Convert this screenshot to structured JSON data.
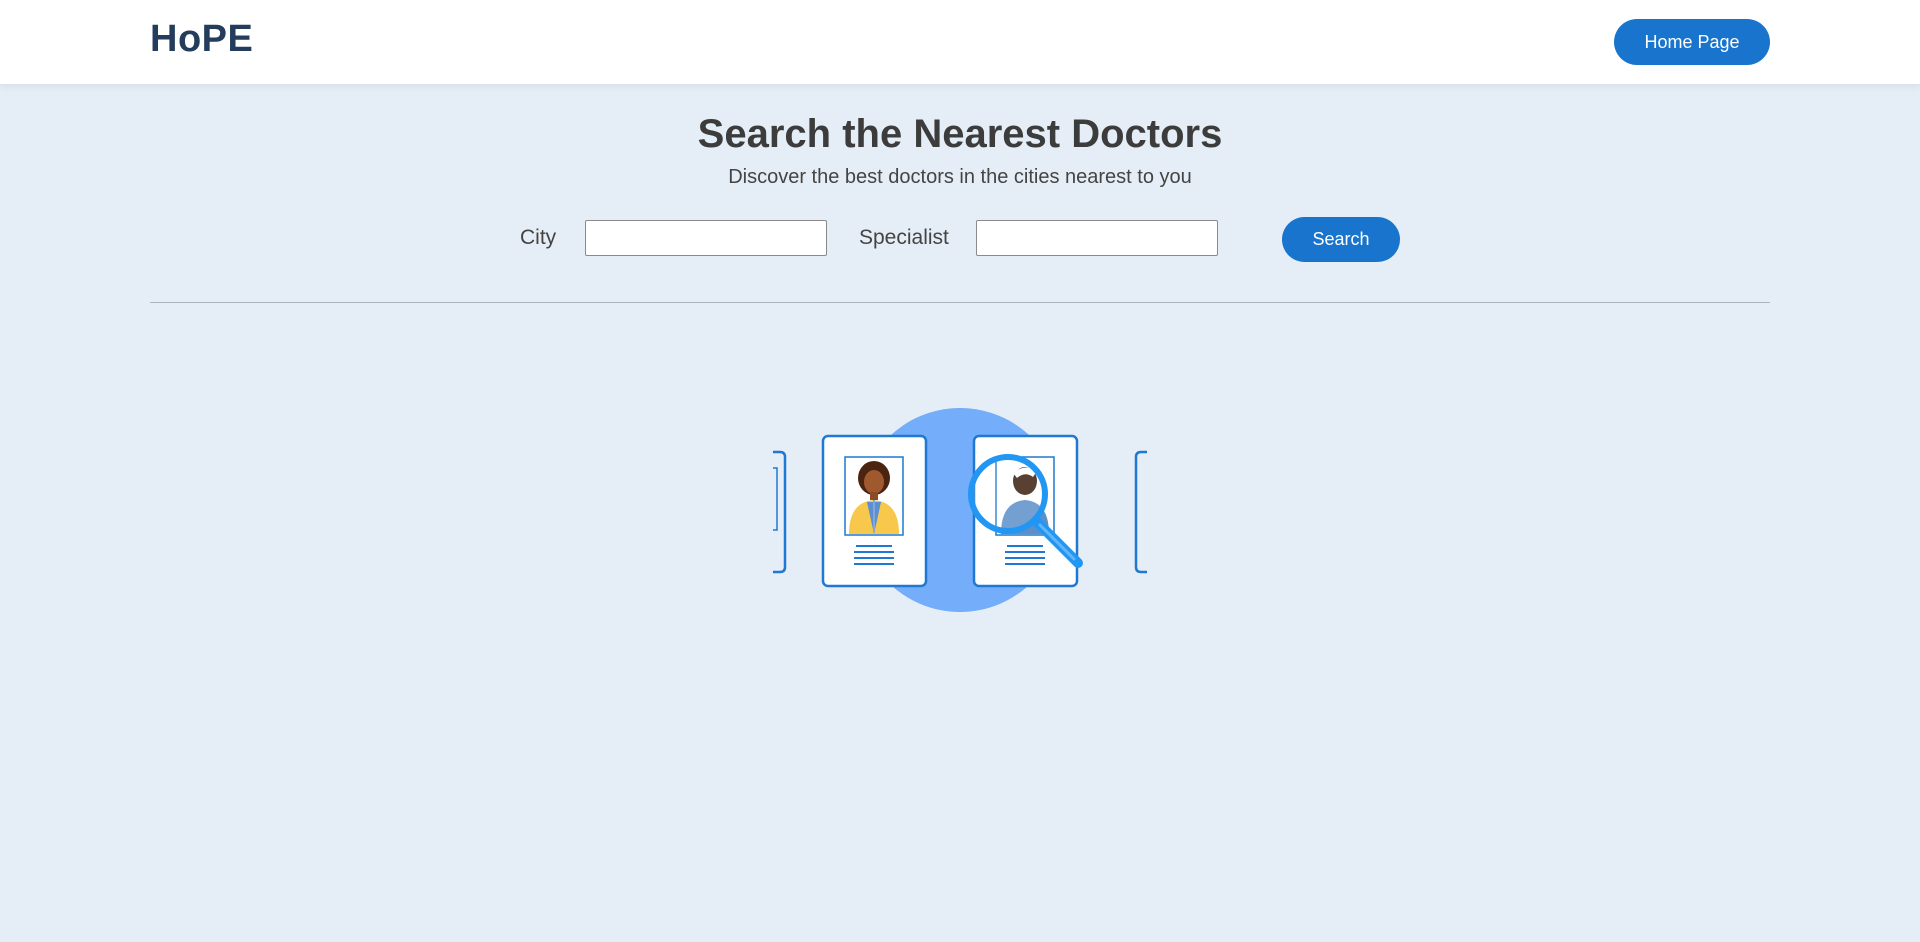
{
  "header": {
    "logo": "HoPE",
    "home_button": "Home Page"
  },
  "main": {
    "title": "Search the Nearest Doctors",
    "subtitle": "Discover the best doctors in the cities nearest to you"
  },
  "search": {
    "city_label": "City",
    "city_value": "",
    "specialist_label": "Specialist",
    "specialist_value": "",
    "button": "Search"
  },
  "icons": {
    "illustration": "doctor-profiles-magnifier-illustration"
  },
  "colors": {
    "accent": "#1874cd",
    "background": "#e5eef6",
    "logo": "#243d5c"
  }
}
